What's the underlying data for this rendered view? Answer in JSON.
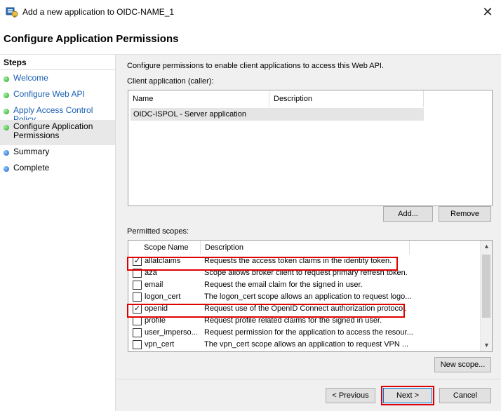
{
  "window": {
    "title": "Add a new application to OIDC-NAME_1",
    "close_glyph": "✕"
  },
  "header": {
    "title": "Configure Application Permissions"
  },
  "steps": {
    "title": "Steps",
    "items": [
      {
        "label": "Welcome",
        "state": "done"
      },
      {
        "label": "Configure Web API",
        "state": "done"
      },
      {
        "label": "Apply Access Control Policy",
        "state": "done"
      },
      {
        "label": "Configure Application Permissions",
        "state": "current"
      },
      {
        "label": "Summary",
        "state": "pending"
      },
      {
        "label": "Complete",
        "state": "pending"
      }
    ]
  },
  "main": {
    "description": "Configure permissions to enable client applications to access this Web API.",
    "client_label": "Client application (caller):",
    "client_columns": [
      "Name",
      "Description"
    ],
    "client_rows": [
      {
        "name": "OIDC-ISPOL - Server application",
        "description": ""
      }
    ],
    "add_button": "Add...",
    "remove_button": "Remove",
    "permitted_label": "Permitted scopes:",
    "scope_columns": [
      "Scope Name",
      "Description"
    ],
    "scopes": [
      {
        "name": "allatclaims",
        "description": "Requests the access token claims in the identity token.",
        "checked": true,
        "highlighted": true
      },
      {
        "name": "aza",
        "description": "Scope allows broker client to request primary refresh token.",
        "checked": false,
        "highlighted": false
      },
      {
        "name": "email",
        "description": "Request the email claim for the signed in user.",
        "checked": false,
        "highlighted": false
      },
      {
        "name": "logon_cert",
        "description": "The logon_cert scope allows an application to request logo...",
        "checked": false,
        "highlighted": false
      },
      {
        "name": "openid",
        "description": "Request use of the OpenID Connect authorization protocol.",
        "checked": true,
        "highlighted": true
      },
      {
        "name": "profile",
        "description": "Request profile related claims for the signed in user.",
        "checked": false,
        "highlighted": false
      },
      {
        "name": "user_imperso...",
        "description": "Request permission for the application to access the resour...",
        "checked": false,
        "highlighted": false
      },
      {
        "name": "vpn_cert",
        "description": "The vpn_cert scope allows an application to request VPN ...",
        "checked": false,
        "highlighted": false
      }
    ],
    "new_scope_button": "New scope..."
  },
  "footer": {
    "previous_button": "< Previous",
    "next_button": "Next >",
    "cancel_button": "Cancel"
  },
  "colors": {
    "highlight": "#e00000",
    "link": "#1a5fb4",
    "done_dot": "#2aa02a",
    "pending_dot": "#1b62c8"
  }
}
